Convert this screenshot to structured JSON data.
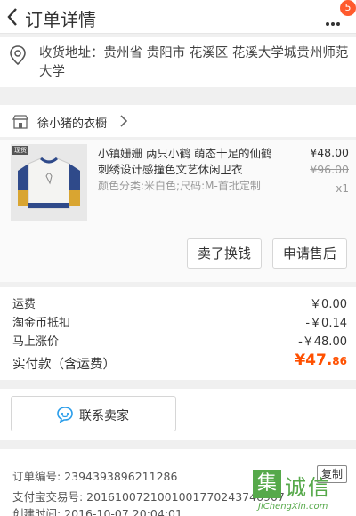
{
  "header": {
    "title": "订单详情",
    "badge": "5"
  },
  "address": {
    "text": "收货地址：贵州省 贵阳市 花溪区 花溪大学城贵州师范大学"
  },
  "shop": {
    "name": "徐小猪的衣橱"
  },
  "product": {
    "title": "小镇姗姗 两只小鹤 萌态十足的仙鹤刺绣设计感撞色文艺休闲卫衣",
    "sku": "颜色分类:米白色;尺码:M-首批定制",
    "price": "¥48.00",
    "original_price": "¥96.00",
    "quantity": "x1",
    "thumb_tag": "现货"
  },
  "actions": {
    "resell": "卖了换钱",
    "aftersale": "申请售后"
  },
  "fees": {
    "shipping_label": "运费",
    "shipping_value": "￥0.00",
    "coins_label": "淘金币抵扣",
    "coins_value": "-￥0.14",
    "rise_label": "马上涨价",
    "rise_value": "-￥48.00",
    "total_label": "实付款（含运费）",
    "total_currency": "¥",
    "total_int": "47.",
    "total_dec": "86"
  },
  "contact": {
    "label": "联系卖家"
  },
  "order": {
    "number_line": "订单编号: 2394393896211286",
    "alipay_line": "支付宝交易号: 2016100721001001770243746907",
    "created_line": "创建时间: 2016-10-07 20:04:01",
    "copy_label": "复制"
  },
  "watermark": {
    "char1": "集",
    "chars": "诚信",
    "url": "JiChengXin.com"
  },
  "colors": {
    "accent": "#ff5000",
    "badge": "#ff5a2d",
    "watermark": "#56a94a"
  }
}
